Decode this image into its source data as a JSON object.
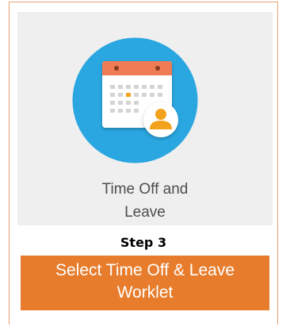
{
  "tile": {
    "label_line1": "Time Off and",
    "label_line2": "Leave",
    "icon": "calendar-person-icon"
  },
  "step_label": "Step 3",
  "banner": {
    "line1": "Select Time Off & Leave",
    "line2": "Worklet"
  },
  "colors": {
    "frame_border": "#e8a070",
    "tile_bg": "#efefef",
    "circle": "#2aa7e1",
    "calendar_header": "#f07c55",
    "person": "#f2a31b",
    "banner_bg": "#e77d2c"
  }
}
